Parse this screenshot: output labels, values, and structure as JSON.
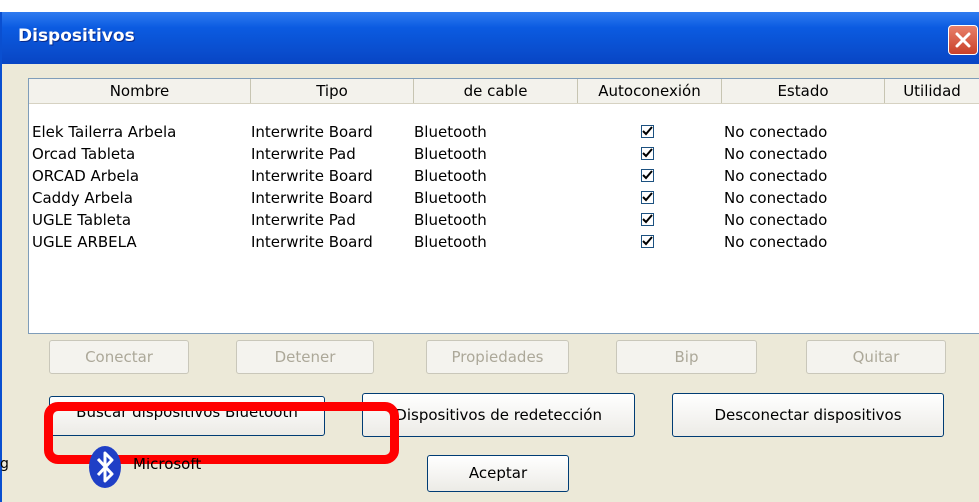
{
  "window": {
    "title": "Dispositivos"
  },
  "columns": [
    "Nombre",
    "Tipo",
    "de cable",
    "Autoconexión",
    "Estado",
    "Utilidad"
  ],
  "devices": [
    {
      "nombre": "Elek Tailerra Arbela",
      "tipo": "Interwrite Board",
      "cable": "Bluetooth",
      "auto": true,
      "estado": "No conectado"
    },
    {
      "nombre": "Orcad Tableta",
      "tipo": "Interwrite Pad",
      "cable": "Bluetooth",
      "auto": true,
      "estado": "No conectado"
    },
    {
      "nombre": "ORCAD Arbela",
      "tipo": "Interwrite Board",
      "cable": "Bluetooth",
      "auto": true,
      "estado": "No conectado"
    },
    {
      "nombre": "Caddy Arbela",
      "tipo": "Interwrite Board",
      "cable": "Bluetooth",
      "auto": true,
      "estado": "No conectado"
    },
    {
      "nombre": "UGLE Tableta",
      "tipo": "Interwrite Pad",
      "cable": "Bluetooth",
      "auto": true,
      "estado": "No conectado"
    },
    {
      "nombre": "UGLE ARBELA",
      "tipo": "Interwrite Board",
      "cable": "Bluetooth",
      "auto": true,
      "estado": "No conectado"
    }
  ],
  "buttons": {
    "conectar": "Conectar",
    "detener": "Detener",
    "propiedades": "Propiedades",
    "bip": "Bip",
    "quitar": "Quitar",
    "buscar": "Buscar dispositivos Bluetooth",
    "redeteccion": "Dispositivos de redetección",
    "desconectar": "Desconectar dispositivos",
    "aceptar": "Aceptar"
  },
  "brand": {
    "microsoft": "Microsoft"
  },
  "edge_mark": "g",
  "colors": {
    "titlebar": "#0a4fd0",
    "highlight": "#ff0000",
    "face": "#ece9d8"
  }
}
